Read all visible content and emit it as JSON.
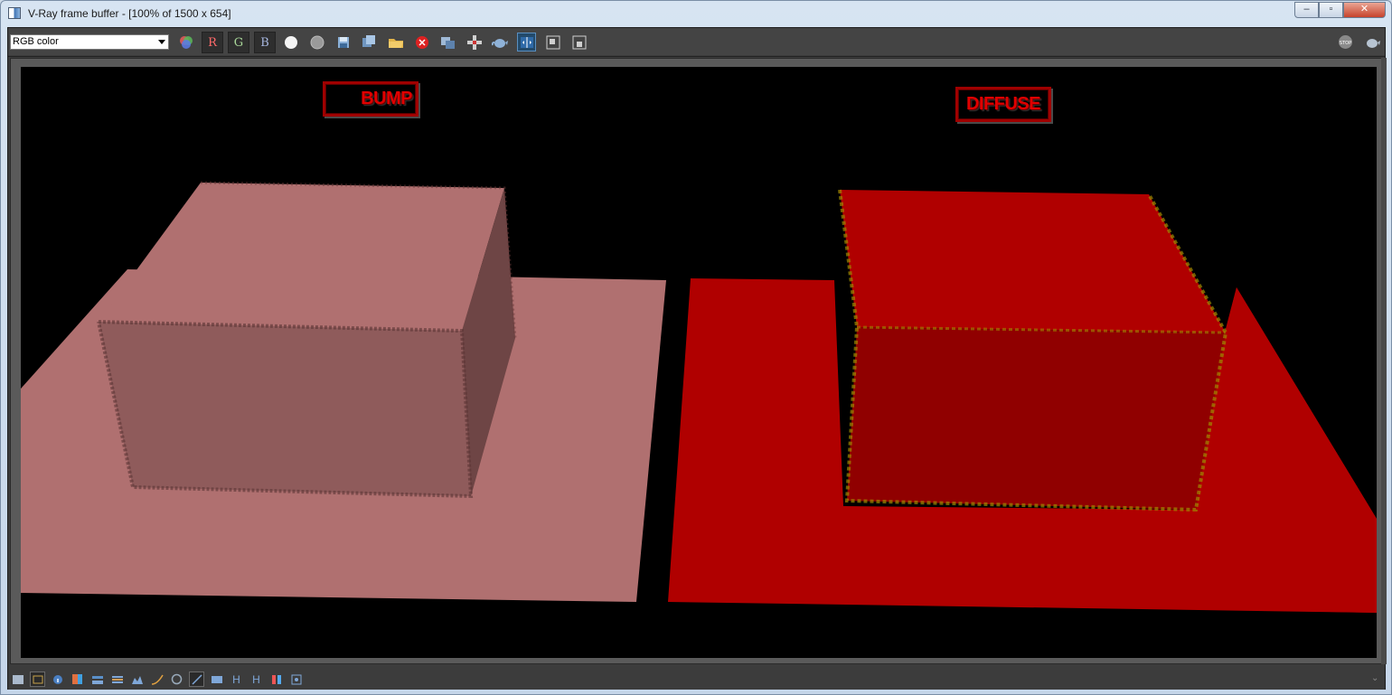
{
  "window": {
    "title": "V-Ray frame buffer - [100% of 1500 x 654]",
    "minimize_label": "‒",
    "maximize_label": "▫",
    "close_label": "✕"
  },
  "toolbar": {
    "channel_select": "RGB color",
    "red_label": "R",
    "green_label": "G",
    "blue_label": "B",
    "icons": [
      "color-correction-icon",
      "red-channel",
      "green-channel",
      "blue-channel",
      "white-sphere-icon",
      "gray-sphere-icon",
      "save-icon",
      "save-all-icon",
      "open-icon",
      "clear-icon",
      "duplicate-icon",
      "track-mouse-icon",
      "teapot-icon",
      "compare-icon",
      "region-a-icon",
      "region-b-icon",
      "stop-icon",
      "render-teapot-icon"
    ]
  },
  "render": {
    "label_bump": "BUMP",
    "label_diffuse": "DIFFUSE",
    "colors": {
      "bump_floor": "#b07070",
      "bump_box_top": "#b07070",
      "bump_box_front": "#8f5b5b",
      "bump_box_side": "#6e4545",
      "diffuse_floor": "#b00000",
      "diffuse_box_top": "#b00000",
      "diffuse_box_front": "#900000",
      "diffuse_edge": "#a08a00"
    }
  },
  "statusbar": {
    "icons": [
      "layers-icon",
      "history-icon",
      "info-icon",
      "color-icon",
      "hsl-icon",
      "levels-icon",
      "histogram-icon",
      "curves-icon",
      "lens-icon",
      "exposure-icon",
      "lut-icon",
      "h-icon",
      "hh-icon",
      "rgb-bars-icon",
      "settings-icon"
    ],
    "h_label": "H",
    "hh_label": "H"
  }
}
